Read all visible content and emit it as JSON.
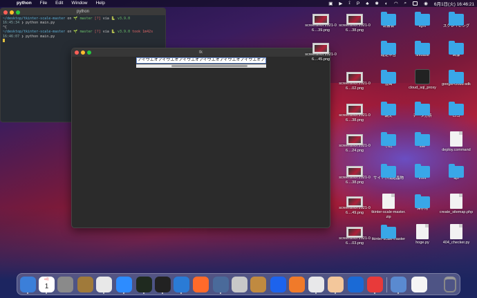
{
  "menubar": {
    "app": "python",
    "items": [
      "File",
      "Edit",
      "Window",
      "Help"
    ],
    "clock": "6月1日(火) 16:46:21"
  },
  "terminal": {
    "title": "python",
    "lines": [
      {
        "path": "~/desktop/tkinter-scale-master",
        "on": " on ",
        "branch": "🌱 master",
        "flags": " [?]",
        "via": " via ",
        "ver": "🐍 v3.9.0"
      },
      {
        "time": "16:45:34",
        "cmd": " ❯ python main.py"
      },
      {
        "text": "^C"
      },
      {
        "path": "~/desktop/tkinter-scale-master",
        "on": " on ",
        "branch": "🌱 master",
        "flags": " [?]",
        "via": " via ",
        "ver": "🐍 v3.9.0",
        "took": " took 1m42s"
      },
      {
        "time": "16:46:07",
        "cmd": " ❯ python main.py"
      }
    ]
  },
  "tk": {
    "title": "tk",
    "entry_value": "アイウエオアイウエオアイウエオアイウエオアイウエオアイウエオアイウ",
    "scroll_position": 0.65
  },
  "desktop_icons": [
    {
      "kind": "shot",
      "label": "screenshot 2021-06....39.png"
    },
    {
      "kind": "shot",
      "label": "screenshot 2021-06....38.png"
    },
    {
      "kind": "folder",
      "label": "読書会"
    },
    {
      "kind": "folder",
      "label": "light"
    },
    {
      "kind": "folder",
      "label": "スクレイピング"
    },
    {
      "kind": "shot",
      "label": "screenshot 2021-06....45.png"
    },
    {
      "kind": "folder",
      "label": "確定申告"
    },
    {
      "kind": "folder",
      "label": "firebase"
    },
    {
      "kind": "folder",
      "label": "画像"
    },
    {
      "kind": "shot",
      "label": "screenshot 2021-06....02.png"
    },
    {
      "kind": "folder",
      "label": "漫画"
    },
    {
      "kind": "term",
      "label": "cloud_sql_proxy"
    },
    {
      "kind": "folder",
      "label": "google-cloud-sdk"
    },
    {
      "kind": "shot",
      "label": "screenshot 2021-06....38.png"
    },
    {
      "kind": "folder",
      "label": "論文"
    },
    {
      "kind": "folder",
      "label": "データ分析"
    },
    {
      "kind": "folder",
      "label": "ロゴ"
    },
    {
      "kind": "shot",
      "label": "screenshot 2021-06....24.png"
    },
    {
      "kind": "folder",
      "label": "小説"
    },
    {
      "kind": "folder",
      "label": "site"
    },
    {
      "kind": "doc",
      "label": "deploy.command"
    },
    {
      "kind": "shot",
      "label": "screenshot 2021-06....38.png"
    },
    {
      "kind": "folder",
      "label": "サイト作成結晶物"
    },
    {
      "kind": "folder",
      "label": "front"
    },
    {
      "kind": "folder",
      "label": "api"
    },
    {
      "kind": "shot",
      "label": "screenshot 2021-06....49.png"
    },
    {
      "kind": "doc",
      "label": "tkinter-scale-master.zip"
    },
    {
      "kind": "folder",
      "label": "保存用"
    },
    {
      "kind": "doc",
      "label": "create_sitemap.php"
    },
    {
      "kind": "shot",
      "label": "screenshot 2021-06....03.png"
    },
    {
      "kind": "folder",
      "label": "tkinter-scale-master"
    },
    {
      "kind": "doc",
      "label": "hoge.py"
    },
    {
      "kind": "doc",
      "label": "404_checker.py"
    }
  ],
  "dock": {
    "calendar_month": "6月",
    "calendar_day": "1",
    "apps": [
      "finder-icon",
      "calendar-icon",
      "system-preferences-icon",
      "keychain-icon",
      "chrome-icon",
      "zoom-icon",
      "terminal-icon",
      "terminal-alt-icon",
      "vscode-icon",
      "safari-icon",
      "quicktime-icon",
      "sequel-icon",
      "archive-icon",
      "docker-icon",
      "sourcetree-icon",
      "proxyman-icon",
      "preview-icon",
      "infinity-icon",
      "clock-icon",
      "photos-icon",
      "document-icon",
      "trash-icon"
    ],
    "colors": [
      "#3b7fd9",
      "#ffffff",
      "#8a8a8a",
      "#a07a3a",
      "#e8e8e8",
      "#2d8cff",
      "#1f2a1f",
      "#222222",
      "#2a7bd6",
      "#ff6a2a",
      "#4a6a9a",
      "#c8c8c8",
      "#c08a40",
      "#1d63ed",
      "#f07a2a",
      "#e8e8ea",
      "#f3c79b",
      "#1a6ad6",
      "#e83a3a",
      "#5a8ad0",
      "#f5f5f5",
      "#777777"
    ]
  }
}
